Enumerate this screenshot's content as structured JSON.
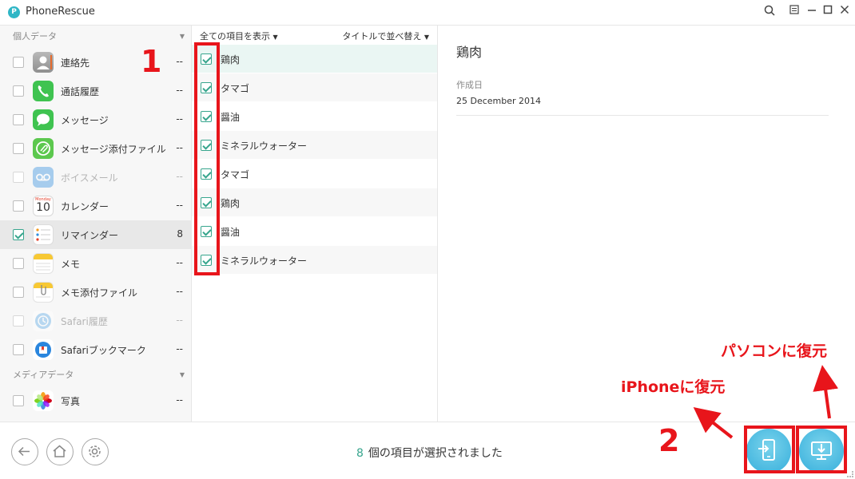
{
  "window": {
    "title": "PhoneRescue",
    "logo_letter": "P"
  },
  "sidebar": {
    "personal_header": "個人データ",
    "media_header": "メディアデータ",
    "items": [
      {
        "label": "連絡先",
        "count": "--"
      },
      {
        "label": "通話履歴",
        "count": "--"
      },
      {
        "label": "メッセージ",
        "count": "--"
      },
      {
        "label": "メッセージ添付ファイル",
        "count": "--"
      },
      {
        "label": "ボイスメール",
        "count": "--"
      },
      {
        "label": "カレンダー",
        "count": "--"
      },
      {
        "label": "リマインダー",
        "count": "8"
      },
      {
        "label": "メモ",
        "count": "--"
      },
      {
        "label": "メモ添付ファイル",
        "count": "--"
      },
      {
        "label": "Safari履歴",
        "count": "--"
      },
      {
        "label": "Safariブックマーク",
        "count": "--"
      },
      {
        "label": "写真",
        "count": "--"
      }
    ],
    "calendar_day": "Monday",
    "calendar_date": "10"
  },
  "list": {
    "show_all": "全ての項目を表示",
    "sort_by": "タイトルで並べ替え",
    "rows": [
      "鶏肉",
      "タマゴ",
      "醤油",
      "ミネラルウォーター",
      "タマゴ",
      "鶏肉",
      "醤油",
      "ミネラルウォーター"
    ]
  },
  "detail": {
    "title": "鶏肉",
    "created_label": "作成日",
    "created_value": "25 December 2014"
  },
  "status": {
    "count": "8",
    "text": "個の項目が選択されました"
  },
  "annotations": {
    "step1": "1",
    "step2": "2",
    "restore_iphone": "iPhoneに復元",
    "restore_pc": "パソコンに復元"
  },
  "colors": {
    "accent": "#37a58d",
    "annotation": "#e8151b",
    "action_button": "#35aedb"
  }
}
